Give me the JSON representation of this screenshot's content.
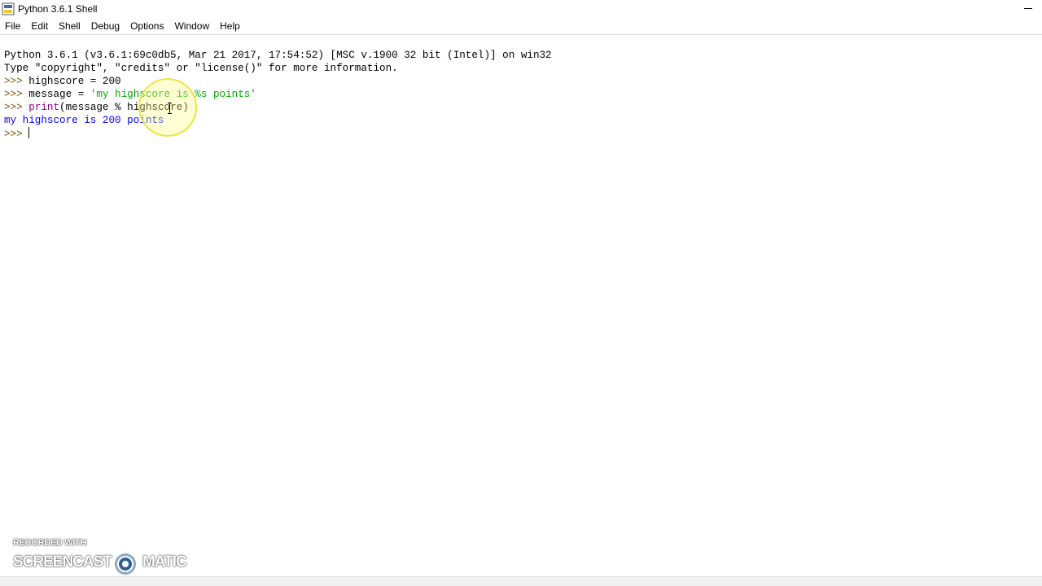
{
  "window": {
    "title": "Python 3.6.1 Shell",
    "icon": "python-icon"
  },
  "menubar": {
    "items": [
      {
        "label": "File"
      },
      {
        "label": "Edit"
      },
      {
        "label": "Shell"
      },
      {
        "label": "Debug"
      },
      {
        "label": "Options"
      },
      {
        "label": "Window"
      },
      {
        "label": "Help"
      }
    ]
  },
  "shell": {
    "banner_line1": "Python 3.6.1 (v3.6.1:69c0db5, Mar 21 2017, 17:54:52) [MSC v.1900 32 bit (Intel)] on win32",
    "banner_line2": "Type \"copyright\", \"credits\" or \"license()\" for more information.",
    "prompt": ">>> ",
    "cmd1": "highscore = 200",
    "cmd2_pre": "message = ",
    "cmd2_str": "'my highscore is %s points'",
    "cmd3_builtin": "print",
    "cmd3_rest": "(message % highscore)",
    "output1": "my highscore is 200 points",
    "final_prompt": ">>> "
  },
  "watermark": {
    "top": "RECORDED WITH",
    "left": "SCREENCAST",
    "right": "MATIC"
  },
  "colors": {
    "prompt": "#7a4f00",
    "string": "#00aa00",
    "builtin": "#900090",
    "stdout": "#0000ff"
  }
}
